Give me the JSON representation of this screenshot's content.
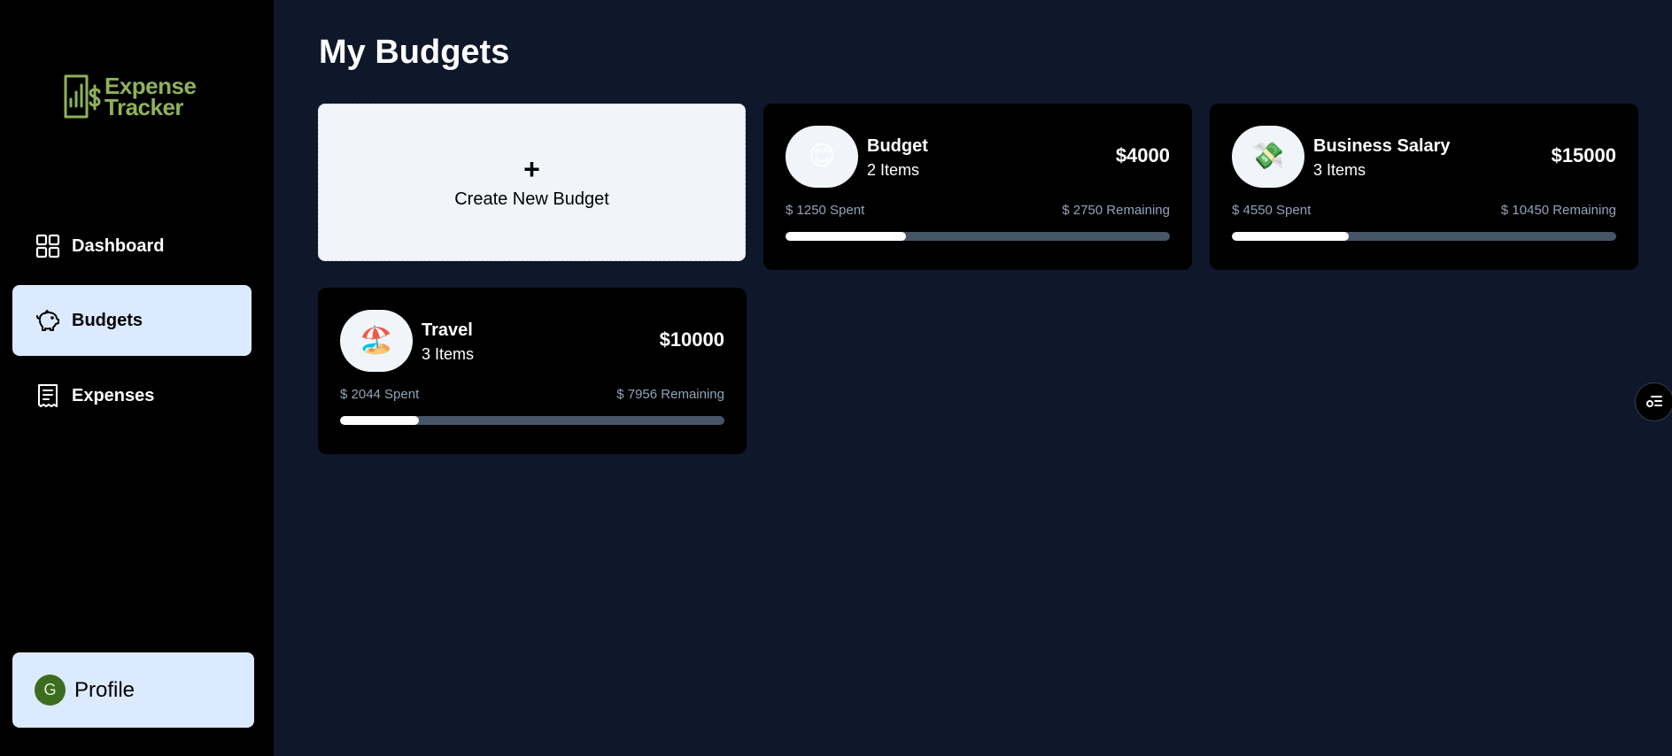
{
  "brand": {
    "line1": "Expense",
    "line2": "Tracker",
    "color": "#8fb25a"
  },
  "sidebar": {
    "items": [
      {
        "label": "Dashboard",
        "icon": "grid-icon",
        "active": false
      },
      {
        "label": "Budgets",
        "icon": "piggy-bank-icon",
        "active": true
      },
      {
        "label": "Expenses",
        "icon": "receipt-icon",
        "active": false
      }
    ],
    "profile": {
      "avatar_initial": "G",
      "label": "Profile"
    }
  },
  "main": {
    "title": "My Budgets",
    "create": {
      "plus": "+",
      "label": "Create New Budget"
    },
    "budgets": [
      {
        "emoji": "😊",
        "name": "Budget",
        "items": "2 Items",
        "amount": "$4000",
        "spent": "$ 1250 Spent",
        "remaining": "$ 2750 Remaining",
        "progress": 0.3125
      },
      {
        "emoji": "💸",
        "name": "Business Salary",
        "items": "3 Items",
        "amount": "$15000",
        "spent": "$ 4550 Spent",
        "remaining": "$ 10450 Remaining",
        "progress": 0.3033
      },
      {
        "emoji": "🏖️",
        "name": "Travel",
        "items": "3 Items",
        "amount": "$10000",
        "spent": "$ 2044 Spent",
        "remaining": "$ 7956 Remaining",
        "progress": 0.2044
      }
    ]
  },
  "colors": {
    "background": "#0f172a",
    "sidebar": "#000000",
    "active_nav": "#dbeafe",
    "progress_track": "#475569"
  }
}
